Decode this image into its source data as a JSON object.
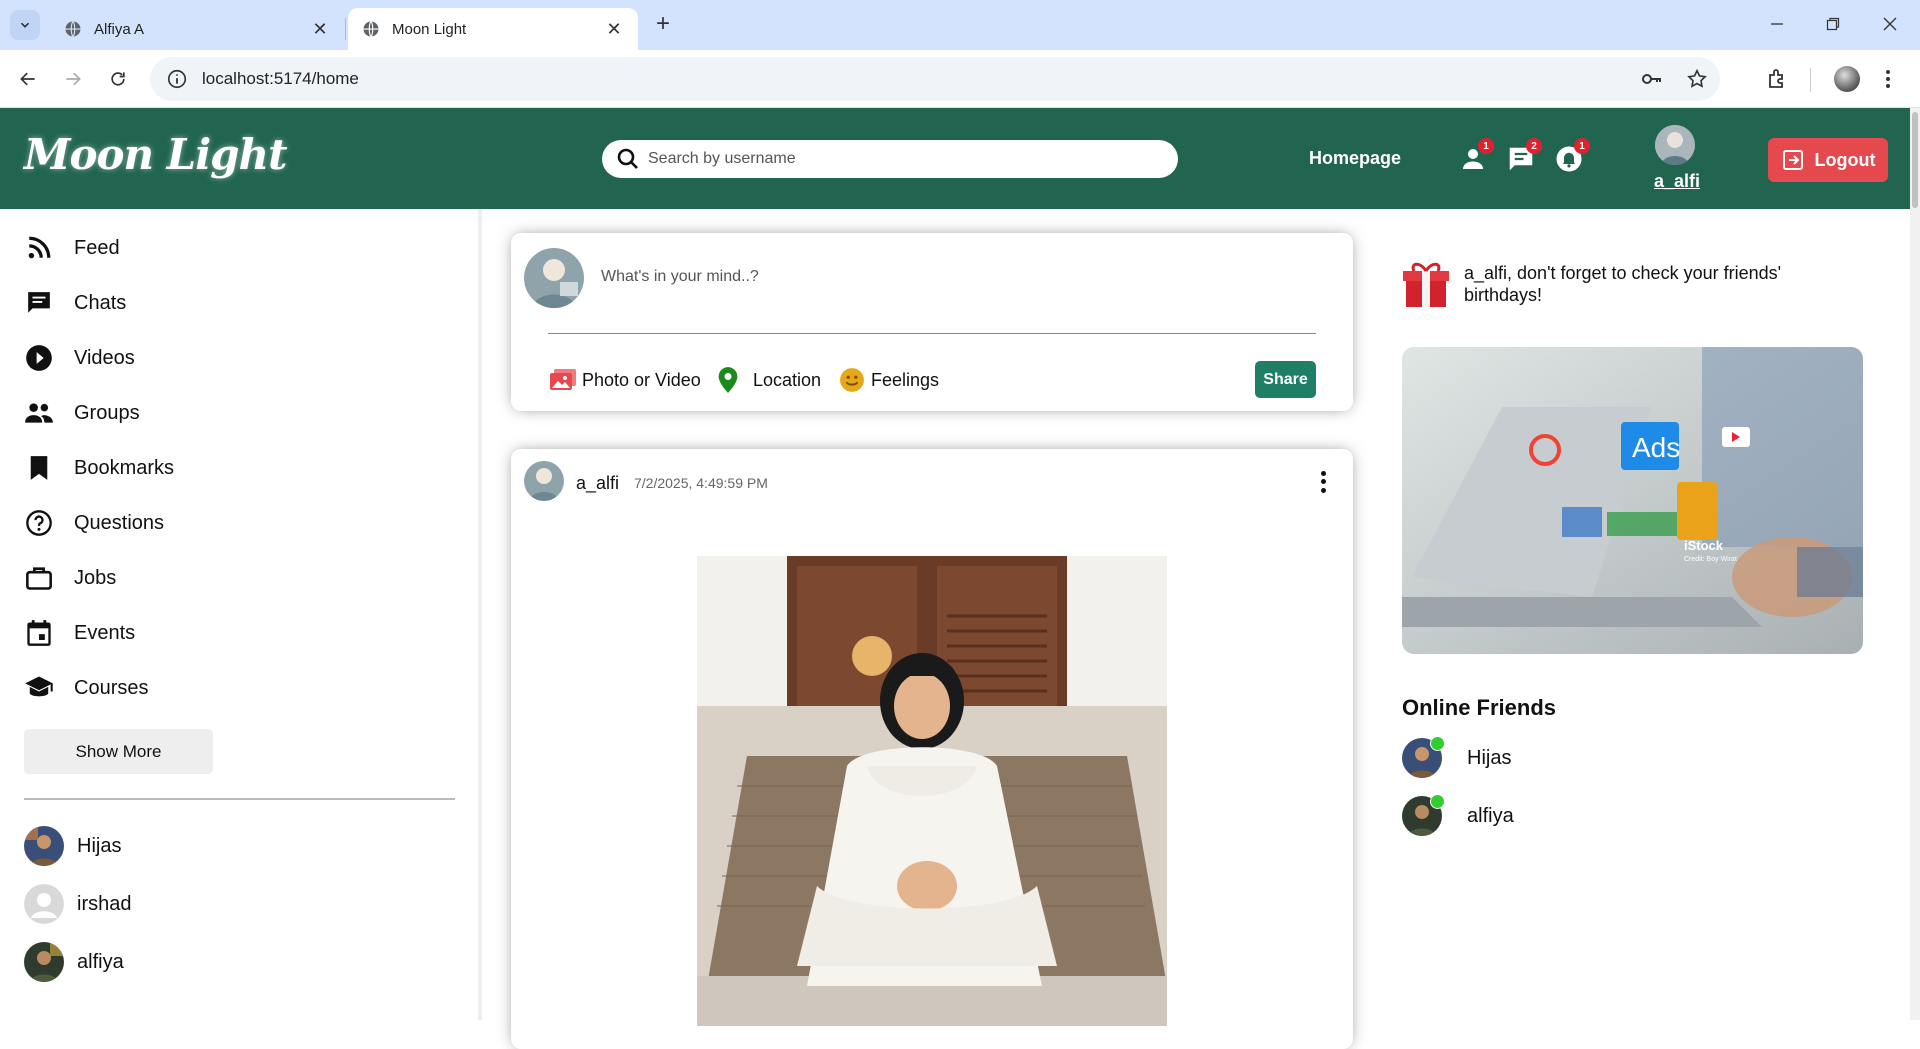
{
  "browser": {
    "tabs": [
      {
        "title": "Alfiya A",
        "active": false
      },
      {
        "title": "Moon Light",
        "active": true
      }
    ],
    "url": "localhost:5174/home"
  },
  "header": {
    "logo": "Moon Light",
    "search_placeholder": "Search by username",
    "homepage_label": "Homepage",
    "badges": {
      "friends": "1",
      "messages": "2",
      "notifications": "1"
    },
    "username": "a_alfi",
    "logout_label": "Logout",
    "colors": {
      "header_bg": "#216550",
      "logout_bg": "#e5484d",
      "badge": "#e0222e"
    }
  },
  "sidebar": {
    "items": [
      {
        "label": "Feed",
        "icon": "rss-icon"
      },
      {
        "label": "Chats",
        "icon": "chat-icon"
      },
      {
        "label": "Videos",
        "icon": "play-circle-icon"
      },
      {
        "label": "Groups",
        "icon": "group-icon"
      },
      {
        "label": "Bookmarks",
        "icon": "bookmark-icon"
      },
      {
        "label": "Questions",
        "icon": "help-icon"
      },
      {
        "label": "Jobs",
        "icon": "briefcase-icon"
      },
      {
        "label": "Events",
        "icon": "calendar-icon"
      },
      {
        "label": "Courses",
        "icon": "school-icon"
      }
    ],
    "show_more_label": "Show More",
    "friends": [
      {
        "name": "Hijas"
      },
      {
        "name": "irshad"
      },
      {
        "name": "alfiya"
      }
    ]
  },
  "share": {
    "placeholder": "What's in your mind..?",
    "options": [
      {
        "label": "Photo or Video",
        "icon": "photo-icon",
        "color": "#e5484d"
      },
      {
        "label": "Location",
        "icon": "location-pin-icon",
        "color": "#1a8a1a"
      },
      {
        "label": "Feelings",
        "icon": "smiley-icon",
        "color": "#e6a817"
      }
    ],
    "share_label": "Share",
    "share_color": "#1f7e66"
  },
  "post": {
    "username": "a_alfi",
    "date": "7/2/2025, 4:49:59 PM"
  },
  "rightbar": {
    "birthday_text": "a_alfi, don't forget to check your friends' birthdays!",
    "ad_title": "Ads",
    "ad_credit_title": "iStock",
    "ad_credit": "Credit: Boy Wirat",
    "online_title": "Online Friends",
    "online_friends": [
      {
        "name": "Hijas"
      },
      {
        "name": "alfiya"
      }
    ],
    "online_color": "#32cd32"
  }
}
